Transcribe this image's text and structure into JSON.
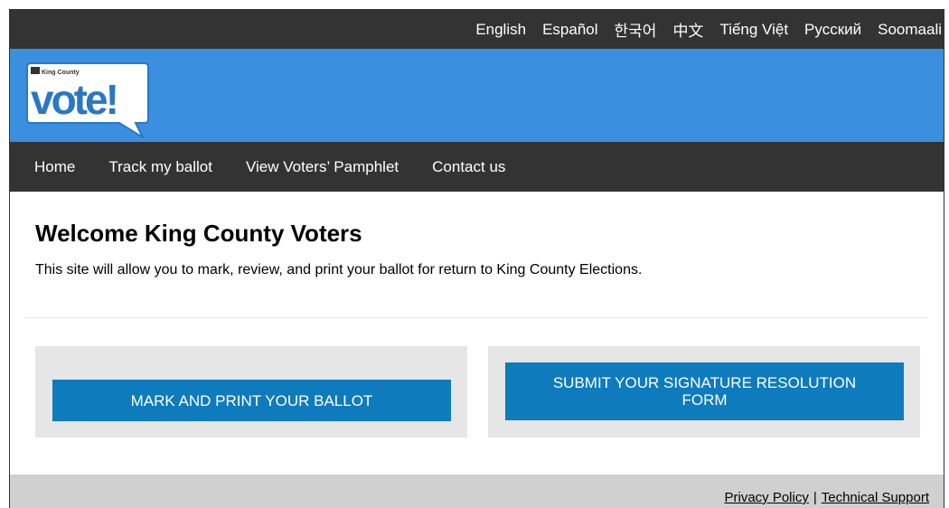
{
  "languages": [
    "English",
    "Español",
    "한국어",
    "中文",
    "Tiếng Việt",
    "Русский",
    "Soomaali"
  ],
  "logo": {
    "county_text": "King County",
    "vote_text": "vote!"
  },
  "nav": {
    "items": [
      "Home",
      "Track my ballot",
      "View Voters’ Pamphlet",
      "Contact us"
    ]
  },
  "main": {
    "title": "Welcome King County Voters",
    "intro": "This site will allow you to mark, review, and print your ballot for return to King County Elections."
  },
  "actions": {
    "mark_print": "MARK AND PRINT YOUR BALLOT",
    "signature_line1": "SUBMIT YOUR SIGNATURE RESOLUTION",
    "signature_line2": "FORM"
  },
  "footer": {
    "privacy": "Privacy Policy",
    "separator": "|",
    "support": "Technical Support"
  },
  "colors": {
    "dark_bar": "#333333",
    "banner_blue": "#3a8fde",
    "button_blue": "#0e7bbd",
    "card_grey": "#e6e6e6",
    "footer_grey": "#d0d0d0"
  }
}
